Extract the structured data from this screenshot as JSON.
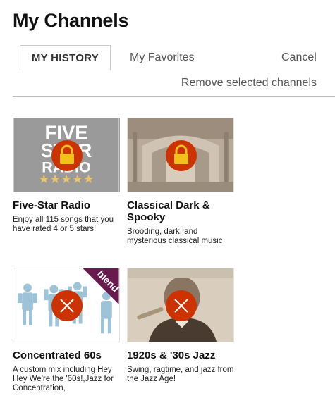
{
  "page": {
    "title": "My Channels"
  },
  "tabs": {
    "history": "MY HISTORY",
    "favorites": "My Favorites",
    "cancel": "Cancel"
  },
  "actions": {
    "remove_selected": "Remove selected channels"
  },
  "channels": [
    {
      "title": "Five-Star Radio",
      "description": "Enjoy all 115 songs that you have rated 4 or 5 stars!",
      "state": "locked",
      "art_text": [
        "FIVE",
        "STAR",
        "RADIO"
      ],
      "stars": 5
    },
    {
      "title": "Classical Dark & Spooky",
      "description": "Brooding, dark, and mysterious classical music",
      "state": "locked"
    },
    {
      "title": "Concentrated 60s",
      "description": "A custom mix including Hey Hey We're the '60s!,Jazz for Concentration,",
      "state": "removable",
      "badge": "blend"
    },
    {
      "title": "1920s & '30s Jazz",
      "description": "Swing, ragtime, and jazz from the Jazz Age!",
      "state": "removable"
    }
  ],
  "colors": {
    "lock_circle": "#cc3300",
    "lock_body": "#f2c21b",
    "remove_circle": "#cc3300",
    "blend_badge": "#6a1b4d",
    "star": "#e8c56a"
  },
  "icons": {
    "lock": "lock-icon",
    "remove": "close-icon"
  }
}
